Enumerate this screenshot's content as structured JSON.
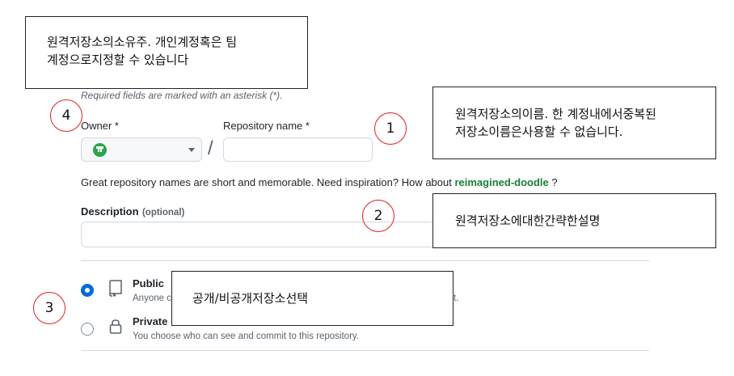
{
  "annotations": {
    "top_note": "원격저장소의소유주. 개인계정혹은 팀\n계정으로지정할 수 있습니다",
    "name_note": "원격저장소의이름. 한 계정내에서중복된\n저장소이름은사용할 수 없습니다.",
    "desc_note": "원격저장소에대한간략한설명",
    "visibility_note": "공개/비공개저장소선택",
    "markers": [
      "1",
      "2",
      "3",
      "4"
    ]
  },
  "form": {
    "required_note": "Required fields are marked with an asterisk (*).",
    "owner_label": "Owner *",
    "repo_name_label": "Repository name *",
    "repo_name_value": "",
    "separator": "/",
    "hint_prefix": "Great repository names are short and memorable. Need inspiration? How about ",
    "hint_suggestion": "reimagined-doodle",
    "hint_suffix": " ?",
    "description_label": "Description",
    "description_optional": "(optional)",
    "description_value": ""
  },
  "visibility": {
    "public_label": "Public",
    "public_desc_visible_start": "Anyone c",
    "public_desc_visible_end": "t.",
    "private_label": "Private",
    "private_desc": "You choose who can see and commit to this repository.",
    "selected": "public"
  },
  "colors": {
    "marker_ring": "#e02020",
    "accent_blue": "#0969da",
    "suggestion_green": "#1a7f37"
  }
}
